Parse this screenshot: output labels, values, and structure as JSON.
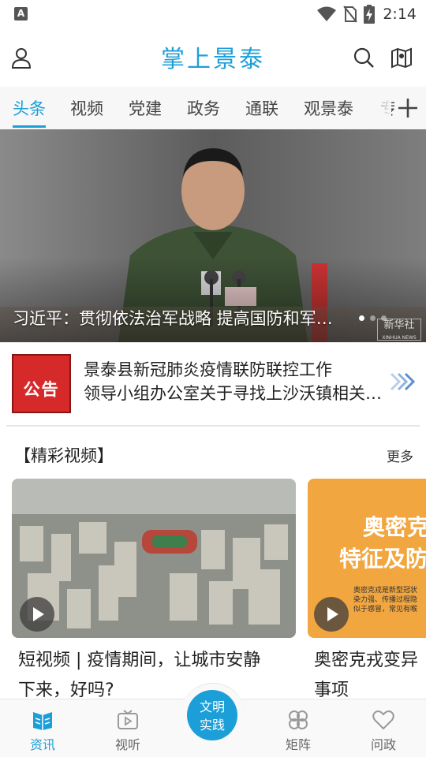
{
  "colors": {
    "accent": "#1c9fd8",
    "notice_red": "#d62a2a",
    "nav_inactive": "#999999"
  },
  "status_bar": {
    "left_badge": "A",
    "time": "2:14",
    "icons": [
      "wifi-icon",
      "no-sim-icon",
      "battery-charging-icon"
    ]
  },
  "header": {
    "title": "掌上景泰",
    "left_icon": "user-icon",
    "right_icons": [
      "search-icon",
      "map-icon"
    ]
  },
  "tabs": {
    "items": [
      {
        "label": "头条",
        "active": true
      },
      {
        "label": "视频"
      },
      {
        "label": "党建"
      },
      {
        "label": "政务"
      },
      {
        "label": "通联"
      },
      {
        "label": "观景泰"
      },
      {
        "label": "专"
      }
    ],
    "add_icon": "plus-icon"
  },
  "banner": {
    "caption": "习近平：贯彻依法治军战略 提高国防和军队建设法治化水平",
    "watermark_line1": "新华社",
    "watermark_line2": "XINHUA NEWS",
    "page_count": 3,
    "current_page": 1
  },
  "notice": {
    "badge": "公告",
    "line1": "景泰县新冠肺炎疫情联防联控工作",
    "line2": "领导小组办公室关于寻找上沙沃镇相关人员的通告",
    "arrow_icon": "double-chevron-right-icon"
  },
  "videos": {
    "title": "【精彩视频】",
    "more": "更多",
    "items": [
      {
        "title_line1": "短视频 | 疫情期间，让城市安静",
        "title_line2": "下来，好吗?"
      },
      {
        "title_line1": "奥密克戎变异",
        "title_line2": "事项",
        "thumb_heading_1": "奥密克",
        "thumb_heading_2": "特征及防",
        "thumb_small_1": "奥密克戎是新型冠状",
        "thumb_small_2": "染力强、传播过程隐",
        "thumb_small_3": "似于感冒，常见有喉"
      }
    ]
  },
  "bottom_nav": {
    "items": [
      {
        "label": "资讯",
        "icon": "news-icon",
        "active": true
      },
      {
        "label": "视听",
        "icon": "tv-icon"
      },
      {
        "label": "矩阵",
        "icon": "clover-icon"
      },
      {
        "label": "问政",
        "icon": "heart-icon"
      }
    ],
    "center_line1": "文明",
    "center_line2": "实践"
  }
}
